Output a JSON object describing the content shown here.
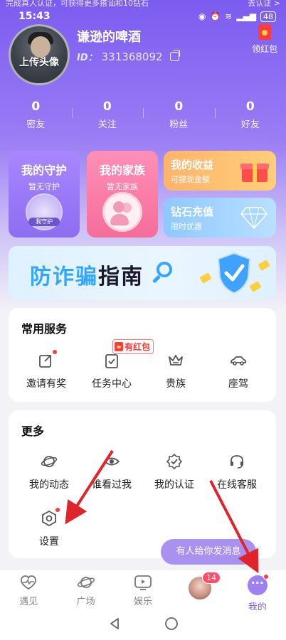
{
  "notice": {
    "left": "完成真人认证，可获得更多搭讪和10钻石",
    "right": "去认证 >"
  },
  "status_bar": {
    "time": "15:43",
    "battery": "48"
  },
  "profile": {
    "avatar_label": "上传头像",
    "username": "谦逊的啤酒",
    "id_label": "ID：",
    "id_value": "331368092",
    "redpack_label": "领红包"
  },
  "stats": [
    {
      "value": "0",
      "label": "密友"
    },
    {
      "value": "0",
      "label": "关注"
    },
    {
      "value": "0",
      "label": "粉丝"
    },
    {
      "value": "0",
      "label": "好友"
    }
  ],
  "cards": {
    "guard": {
      "title": "我的守护",
      "subtitle": "暂无守护",
      "badge": "我守护"
    },
    "family": {
      "title": "我的家族",
      "subtitle": "暂无家族"
    },
    "earnings": {
      "title": "我的收益",
      "subtitle": "可提现金额"
    },
    "recharge": {
      "title": "钻石充值",
      "subtitle": "限时优惠"
    }
  },
  "banner": {
    "part1": "防诈骗",
    "part2": "指南"
  },
  "services": {
    "title": "常用服务",
    "tag": "有红包",
    "items": [
      {
        "label": "邀请有奖",
        "icon": "share-icon"
      },
      {
        "label": "任务中心",
        "icon": "task-icon"
      },
      {
        "label": "贵族",
        "icon": "crown-icon"
      },
      {
        "label": "座驾",
        "icon": "car-icon"
      }
    ]
  },
  "more": {
    "title": "更多",
    "items": [
      {
        "label": "我的动态",
        "icon": "planet-icon"
      },
      {
        "label": "谁看过我",
        "icon": "eye-icon"
      },
      {
        "label": "我的认证",
        "icon": "verified-icon"
      },
      {
        "label": "在线客服",
        "icon": "headset-icon"
      },
      {
        "label": "设置",
        "icon": "settings-icon"
      }
    ]
  },
  "toast": "有人给你发消息",
  "tabbar": {
    "items": [
      {
        "label": "遇见",
        "icon": "heartbeat-icon"
      },
      {
        "label": "广场",
        "icon": "planet-icon"
      },
      {
        "label": "娱乐",
        "icon": "play-icon"
      },
      {
        "label": "",
        "icon": "avatar",
        "badge": "14"
      },
      {
        "label": "我的",
        "icon": "me-icon"
      }
    ]
  },
  "colors": {
    "accent": "#7d5cf2",
    "arrow": "#e0242b",
    "red_dot": "#ff3b3b"
  }
}
